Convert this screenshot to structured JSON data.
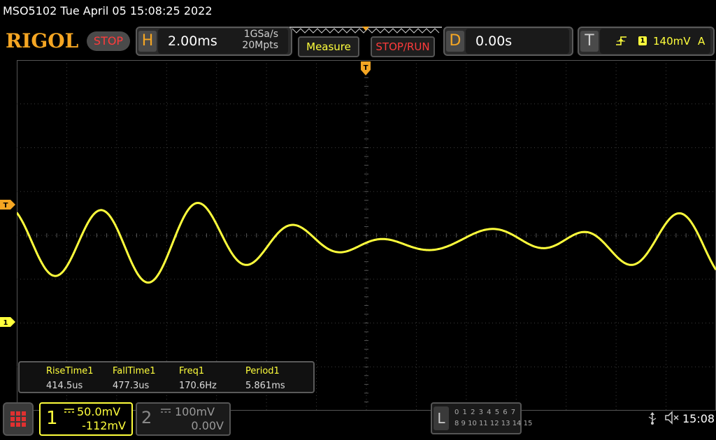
{
  "header": {
    "title": "MSO5102  Tue April 05 15:08:25 2022",
    "logo": "RIGOL",
    "run_status": "STOP"
  },
  "horizontal": {
    "label": "H",
    "timebase": "2.00ms",
    "sample_rate": "1GSa/s",
    "memory_depth": "20Mpts"
  },
  "buttons": {
    "measure": "Measure",
    "stop_run": "STOP/RUN"
  },
  "delay": {
    "label": "D",
    "value": "0.00s"
  },
  "trigger": {
    "label": "T",
    "source": "1",
    "level": "140mV",
    "mode": "A",
    "marker_label": "T"
  },
  "channel1_marker": "1",
  "trigger_position_marker": "T",
  "measurements": {
    "labels": [
      "RiseTime1",
      "FallTime1",
      "Freq1",
      "Period1"
    ],
    "values": [
      "414.5us",
      "477.3us",
      "170.6Hz",
      "5.861ms"
    ]
  },
  "channels": [
    {
      "number": "1",
      "scale": "50.0mV",
      "offset": "-112mV",
      "coupling": "dc",
      "active": true
    },
    {
      "number": "2",
      "scale": "100mV",
      "offset": "0.00V",
      "coupling": "dc",
      "active": false
    }
  ],
  "logic_analyzer": {
    "label": "L",
    "row1": "0 1 2 3  4 5 6 7",
    "row2": "8 9 10 11 12 13 14 15"
  },
  "status": {
    "clock": "15:08"
  },
  "colors": {
    "channel1": "#ffff3c",
    "accent": "#f5a623",
    "stop": "#ff3b3b",
    "grid": "#4a4a4a"
  }
}
